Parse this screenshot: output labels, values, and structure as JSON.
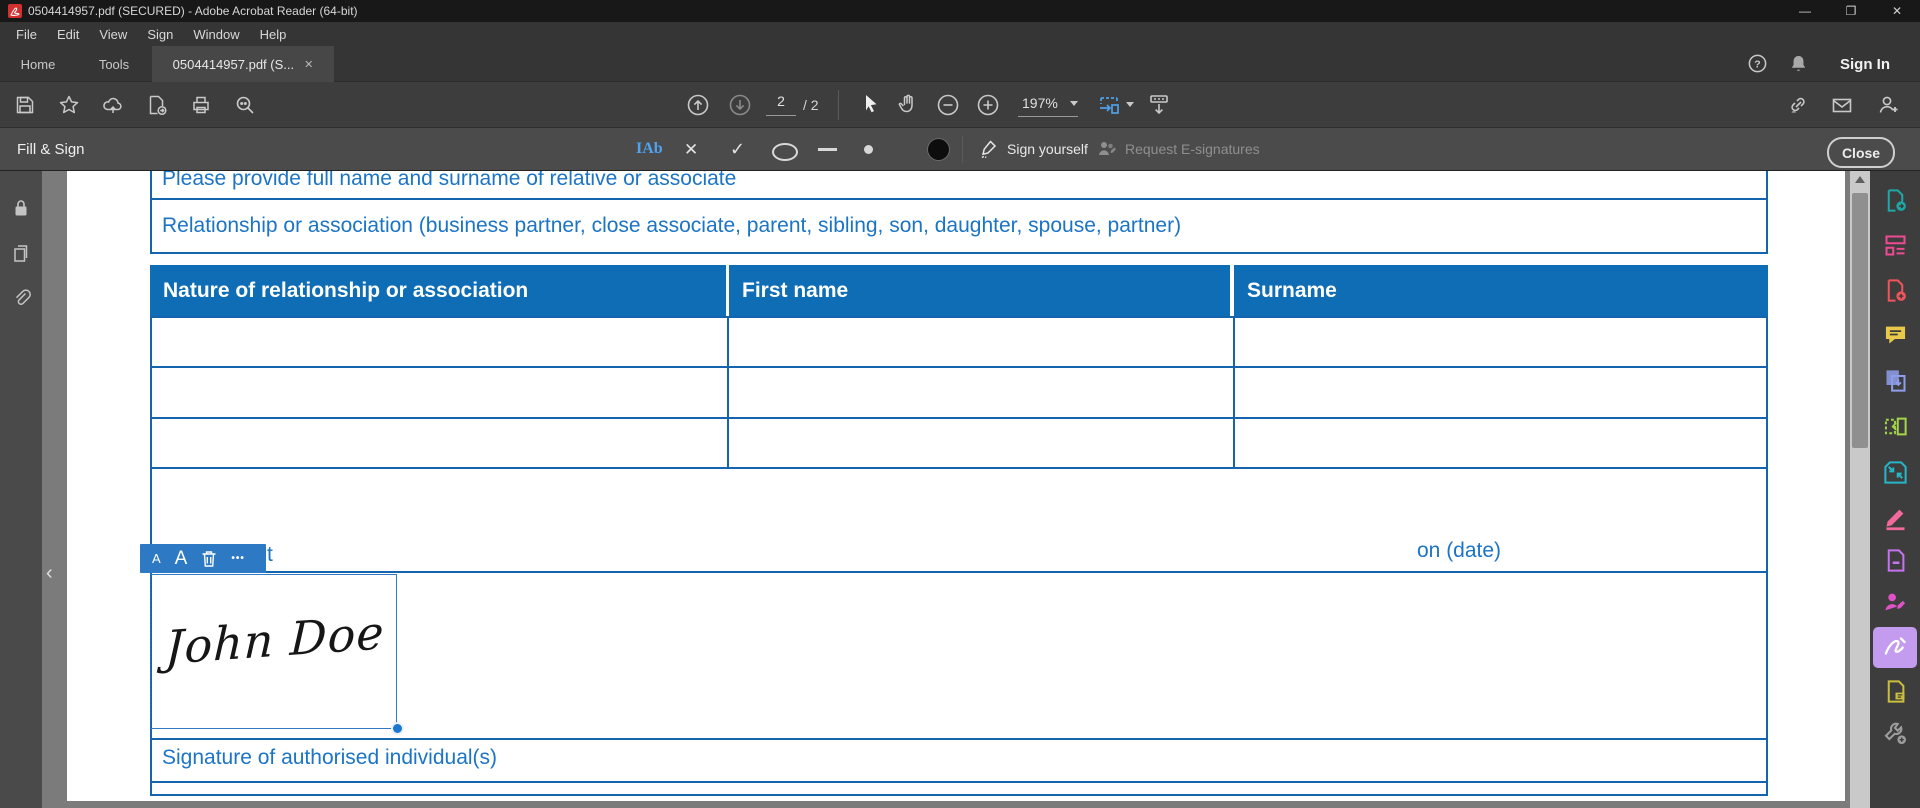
{
  "titlebar": {
    "title": "0504414957.pdf (SECURED) - Adobe Acrobat Reader (64-bit)",
    "minimize": "—",
    "maximize": "❐",
    "close": "✕"
  },
  "menubar": {
    "items": [
      "File",
      "Edit",
      "View",
      "Sign",
      "Window",
      "Help"
    ]
  },
  "tabs": {
    "home": "Home",
    "tools": "Tools",
    "document": "0504414957.pdf (S...",
    "doc_close": "✕"
  },
  "account": {
    "sign_in": "Sign In"
  },
  "toolbar": {
    "page_current": "2",
    "page_total": "/ 2",
    "zoom_level": "197%",
    "left_icons": [
      "save-icon",
      "favorite-star-icon",
      "save-to-cloud-icon",
      "export-file-icon",
      "print-icon",
      "search-icon"
    ],
    "center_icons": [
      "previous-page-icon",
      "next-page-icon",
      "select-tool-icon",
      "hand-tool-icon",
      "zoom-out-icon",
      "zoom-in-icon",
      "fit-width-icon",
      "page-display-icon"
    ],
    "right_icons": [
      "share-link-icon",
      "email-icon",
      "add-account-icon"
    ]
  },
  "fill_sign": {
    "title": "Fill & Sign",
    "text_tool": "IAb",
    "cross_tool": "✕",
    "check_tool": "✓",
    "sign_yourself": "Sign yourself",
    "request_esignatures": "Request E-signatures",
    "close": "Close",
    "tool_icons": [
      "add-text-icon",
      "cross-icon",
      "check-icon",
      "ellipse-icon",
      "line-icon",
      "dot-icon",
      "filled-dot-icon"
    ]
  },
  "left_rail": {
    "icons": [
      "security-lock-icon",
      "page-thumbnails-icon",
      "attachments-icon"
    ],
    "collapse": "‹"
  },
  "right_rail": {
    "items": [
      {
        "name": "export-pdf",
        "color": "#1fa8a8"
      },
      {
        "name": "edit-pdf",
        "color": "#ed4a93"
      },
      {
        "name": "create-pdf",
        "color": "#f2545b"
      },
      {
        "name": "comment",
        "color": "#e8c94a"
      },
      {
        "name": "combine-files",
        "color": "#8e9eea"
      },
      {
        "name": "organize-pages",
        "color": "#a3d449"
      },
      {
        "name": "compress-pdf",
        "color": "#27b5c8"
      },
      {
        "name": "redact",
        "color": "#f2699c"
      },
      {
        "name": "protect-pdf",
        "color": "#c573ee"
      },
      {
        "name": "request-signatures",
        "color": "#e052c8"
      },
      {
        "name": "fill-and-sign",
        "color": "#ffffff"
      },
      {
        "name": "prepare-form",
        "color": "#c9be3e"
      },
      {
        "name": "more-tools",
        "color": "#9e9e9e"
      }
    ],
    "active_item": "fill-and-sign"
  },
  "sig_toolbar": {
    "font_decrease": "A",
    "font_increase": "A",
    "delete_icon": "trash-icon",
    "more": "•••"
  },
  "form": {
    "prompt_top": "Please provide full name and surname of relative or associate",
    "prompt_relationship": "Relationship or association (business partner, close associate, parent, sibling, son, daughter, spouse, partner)",
    "table": {
      "headers": [
        "Nature of relationship or association",
        "First name",
        "Surname"
      ],
      "rows": [
        [
          "",
          "",
          ""
        ],
        [
          "",
          "",
          ""
        ],
        [
          "",
          "",
          ""
        ]
      ]
    },
    "obscured_fragment": "t",
    "date_label": "on (date)",
    "signature_name": "John Doe",
    "signature_caption": "Signature of authorised individual(s)"
  },
  "colors": {
    "form_text_blue": "#1b74c5",
    "form_border_blue": "#1565ae",
    "table_header_blue": "#0e6db5",
    "selection_toolbar_blue": "#2e79c4",
    "resize_handle_blue": "#1d76d2",
    "fill_sign_accent_purple": "#a97fd8",
    "active_tool_highlight": "#c39bef",
    "fit_width_icon_blue": "#4fa0e8"
  }
}
